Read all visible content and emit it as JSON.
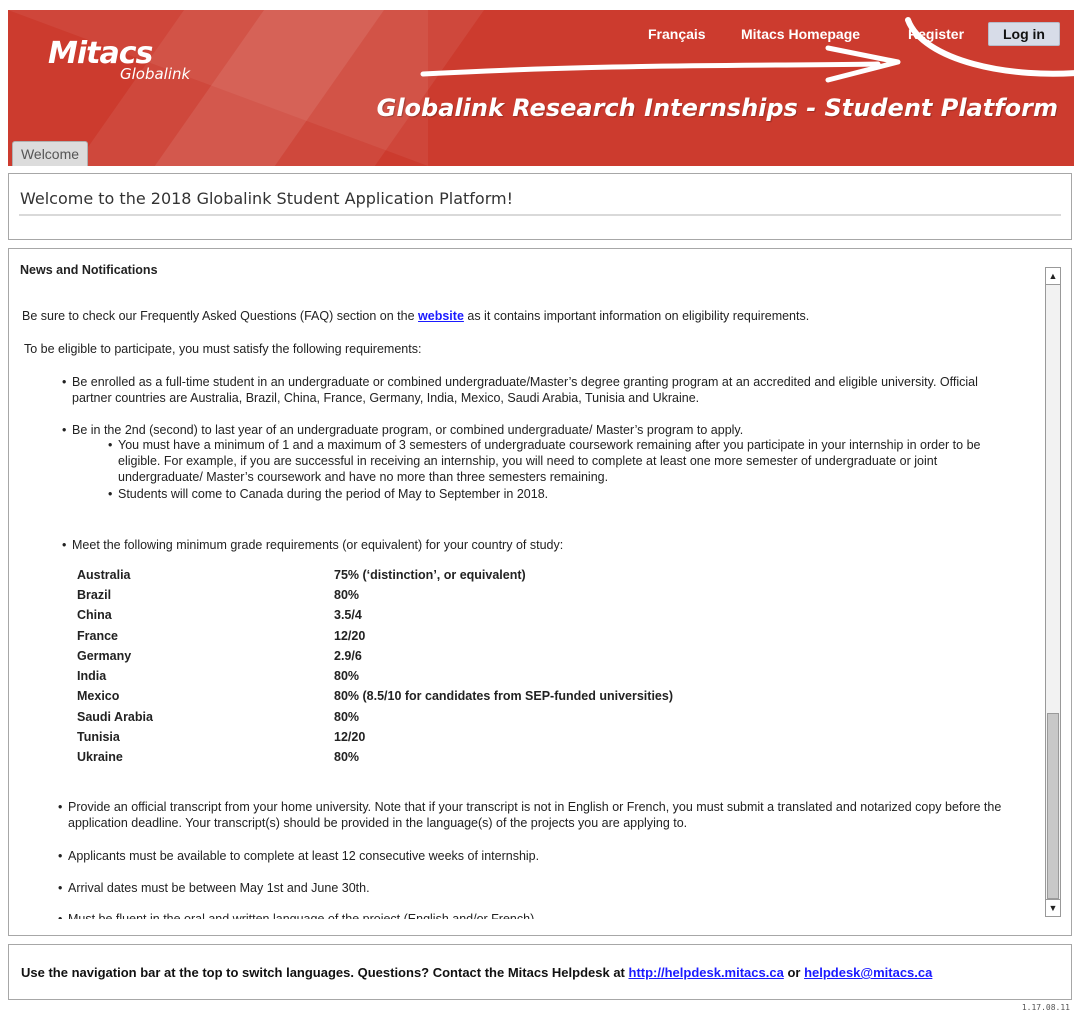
{
  "header": {
    "logo_main": "Mitacs",
    "logo_sub": "Globalink",
    "nav": {
      "french": "Français",
      "homepage": "Mitacs Homepage",
      "register": "Register",
      "login": "Log in"
    },
    "platform_title": "Globalink Research Internships - Student Platform",
    "tab_welcome": "Welcome",
    "colors": {
      "banner": "#cc3b2e",
      "login_bg": "#d7dce8"
    }
  },
  "welcome": {
    "title": "Welcome to the 2018 Globalink Student Application Platform!"
  },
  "news": {
    "heading": "News and Notifications",
    "faq_before": "Be sure to check our Frequently Asked Questions (FAQ) section on the ",
    "faq_link": "website",
    "faq_after": " as it contains important information on eligibility requirements.",
    "eligibility_intro": "To be eligible to participate, you must satisfy the following requirements:",
    "req_enrolled": "Be enrolled as a full-time student in an undergraduate or combined undergraduate/Master’s degree granting program at an accredited and eligible university. Official partner countries are Australia, Brazil, China, France, Germany, India, Mexico, Saudi Arabia, Tunisia and Ukraine.",
    "req_year": "Be in the 2nd (second) to last year of an undergraduate program, or combined undergraduate/ Master’s program to apply.",
    "req_year_sub1": "You must have a minimum of 1 and a maximum of 3 semesters of undergraduate coursework remaining after you participate in your internship in order to be eligible. For example, if you are successful in receiving an internship, you will need to complete at least one more semester of undergraduate or joint undergraduate/ Master’s coursework and have no more than three semesters remaining.",
    "req_year_sub2": "Students will come to Canada during the period of May to September in 2018.",
    "req_grades": "Meet the following minimum grade requirements (or equivalent) for your country of study:",
    "grades": [
      {
        "country": "Australia",
        "grade": "75% (‘distinction’, or equivalent)"
      },
      {
        "country": "Brazil",
        "grade": "80%"
      },
      {
        "country": "China",
        "grade": "3.5/4"
      },
      {
        "country": "France",
        "grade": "12/20"
      },
      {
        "country": "Germany",
        "grade": "2.9/6"
      },
      {
        "country": "India",
        "grade": "80%"
      },
      {
        "country": "Mexico",
        "grade": "80% (8.5/10 for candidates from SEP-funded universities)"
      },
      {
        "country": "Saudi Arabia",
        "grade": "80%"
      },
      {
        "country": "Tunisia",
        "grade": "12/20"
      },
      {
        "country": "Ukraine",
        "grade": "80%"
      }
    ],
    "req_transcript": "Provide an official transcript from your home university. Note that if your transcript is not in English or French, you must submit a translated and notarized copy before the application deadline. Your transcript(s) should be provided in the language(s) of the projects you are applying to.",
    "req_weeks": "Applicants must be available to complete at least 12 consecutive weeks of internship.",
    "req_arrival": "Arrival dates must be between May 1st and June 30th.",
    "req_fluent": "Must be fluent in the oral and written language of the project (English and/or French)."
  },
  "footer": {
    "text_before": "Use the navigation bar at the top to switch languages. Questions? Contact the Mitacs Helpdesk at ",
    "helpdesk_url": "http://helpdesk.mitacs.ca",
    "text_or": " or ",
    "helpdesk_email": "helpdesk@mitacs.ca",
    "link_color": "#1a1aff"
  },
  "version": "1.17.08.11"
}
